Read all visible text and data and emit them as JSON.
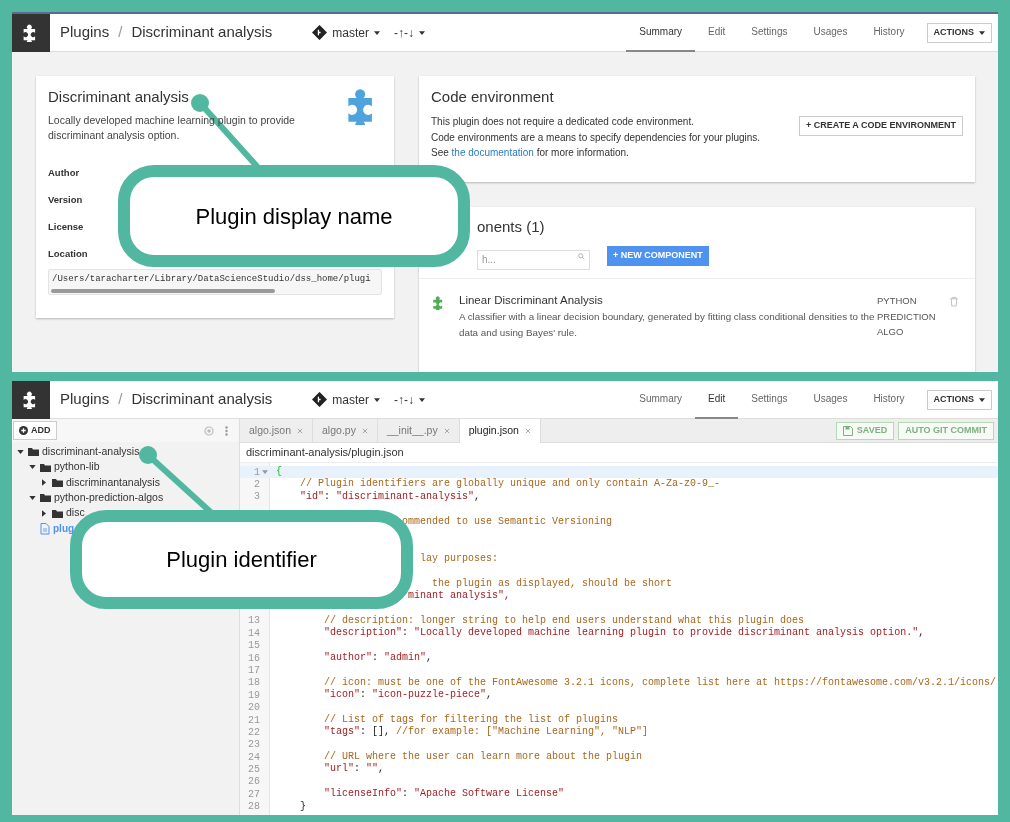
{
  "summary_view": {
    "header": {
      "section": "Plugins",
      "separator": "/",
      "title": "Discriminant analysis",
      "branch": "master",
      "sync": "-↑-↓",
      "tabs": [
        {
          "label": "Summary",
          "selected": true
        },
        {
          "label": "Edit",
          "selected": false
        },
        {
          "label": "Settings",
          "selected": false
        },
        {
          "label": "Usages",
          "selected": false
        },
        {
          "label": "History",
          "selected": false
        }
      ],
      "actions": "ACTIONS"
    },
    "plugin_card": {
      "title": "Discriminant analysis",
      "description": "Locally developed machine learning plugin to provide discriminant analysis option.",
      "fields": [
        "Author",
        "Version",
        "License",
        "Location"
      ],
      "location_value": "/Users/taracharter/Library/DataScienceStudio/dss_home/plugi"
    },
    "code_environment": {
      "title": "Code environment",
      "paragraphs": [
        "This plugin does not require a dedicated code environment.",
        "Code environments are a means to specify dependencies for your plugins."
      ],
      "link_sentence": {
        "before": "See",
        "link": "the documentation",
        "after": "for more information."
      },
      "button": "+ CREATE A CODE ENVIRONMENT"
    },
    "components": {
      "title": "onents (1)",
      "search": {
        "placeholder": "h..."
      },
      "button": "+ NEW COMPONENT",
      "items": [
        {
          "name": "Linear Discriminant Analysis",
          "description": "A classifier with a linear decision boundary, generated by fitting class conditional densities to the data and using Bayes' rule.",
          "tags": [
            "PYTHON",
            "PREDICTION",
            "ALGO"
          ]
        }
      ]
    }
  },
  "edit_view": {
    "header": {
      "section": "Plugins",
      "separator": "/",
      "title": "Discriminant analysis",
      "branch": "master",
      "sync": "-↑-↓",
      "tabs": [
        {
          "label": "Summary",
          "selected": false
        },
        {
          "label": "Edit",
          "selected": true
        },
        {
          "label": "Settings",
          "selected": false
        },
        {
          "label": "Usages",
          "selected": false
        },
        {
          "label": "History",
          "selected": false
        }
      ],
      "actions": "ACTIONS"
    },
    "sidebar": {
      "add_button": "ADD",
      "tree": [
        {
          "kind": "folder",
          "label": "discriminant-analysis",
          "expanded": true,
          "children": [
            {
              "kind": "folder",
              "label": "python-lib",
              "expanded": true,
              "children": [
                {
                  "kind": "folder",
                  "label": "discriminantanalysis",
                  "expanded": false
                }
              ]
            },
            {
              "kind": "folder",
              "label": "python-prediction-algos",
              "expanded": true,
              "children": [
                {
                  "kind": "folder",
                  "label": "disc",
                  "expanded": false
                }
              ]
            },
            {
              "kind": "file",
              "label": "plug",
              "selected": true
            }
          ]
        }
      ]
    },
    "editor": {
      "tabs": [
        {
          "label": "algo.json",
          "selected": false
        },
        {
          "label": "algo.py",
          "selected": false
        },
        {
          "label": "__init__.py",
          "selected": false
        },
        {
          "label": "plugin.json",
          "selected": true
        }
      ],
      "buttons": [
        {
          "label": "SAVED",
          "disabled": true,
          "kind": "save"
        },
        {
          "label": "AUTO GIT COMMIT",
          "disabled": true,
          "kind": "plain"
        }
      ],
      "path": "discriminant-analysis/plugin.json",
      "lines": [
        {
          "kind": "full",
          "number": "1",
          "text": "{",
          "active": true
        },
        {
          "kind": "full",
          "number": "2",
          "text": "    // Plugin identifiers are globally unique and only contain A-Za-z0-9_-"
        },
        {
          "kind": "full",
          "number": "3",
          "text": "    \"id\": \"discriminant-analysis\","
        },
        {
          "kind": "covered"
        },
        {
          "kind": "comment",
          "text": "ommended to use Semantic Versioning"
        },
        {
          "kind": "covered"
        },
        {
          "kind": "covered"
        },
        {
          "kind": "comment",
          "text": "lay purposes:"
        },
        {
          "kind": "covered"
        },
        {
          "kind": "comment",
          "text": "the plugin as displayed, should be short"
        },
        {
          "kind": "string",
          "text": "minant analysis\","
        },
        {
          "kind": "covered"
        },
        {
          "kind": "full",
          "number": "13",
          "text": "        // description: longer string to help end users understand what this plugin does"
        },
        {
          "kind": "full",
          "number": "14",
          "text": "        \"description\": \"Locally developed machine learning plugin to provide discriminant analysis option.\","
        },
        {
          "kind": "full",
          "number": "15"
        },
        {
          "kind": "full",
          "number": "16",
          "text": "        \"author\": \"admin\","
        },
        {
          "kind": "full",
          "number": "17"
        },
        {
          "kind": "full",
          "number": "18",
          "text": "        // icon: must be one of the FontAwesome 3.2.1 icons, complete list here at https://fontawesome.com/v3.2.1/icons/"
        },
        {
          "kind": "full",
          "number": "19",
          "text": "        \"icon\": \"icon-puzzle-piece\","
        },
        {
          "kind": "full",
          "number": "20"
        },
        {
          "kind": "full",
          "number": "21",
          "text": "        // List of tags for filtering the list of plugins"
        },
        {
          "kind": "full",
          "number": "22",
          "text": "        \"tags\": [], //for example: [\"Machine Learning\", \"NLP\"]"
        },
        {
          "kind": "full",
          "number": "23"
        },
        {
          "kind": "full",
          "number": "24",
          "text": "        // URL where the user can learn more about the plugin"
        },
        {
          "kind": "full",
          "number": "25",
          "text": "        \"url\": \"\","
        },
        {
          "kind": "full",
          "number": "26"
        },
        {
          "kind": "full",
          "number": "27",
          "text": "        \"licenseInfo\": \"Apache Software License\""
        },
        {
          "kind": "full",
          "number": "28",
          "text": "    }"
        }
      ]
    }
  },
  "callouts": [
    {
      "text": "Plugin display name"
    },
    {
      "text": "Plugin identifier"
    }
  ]
}
